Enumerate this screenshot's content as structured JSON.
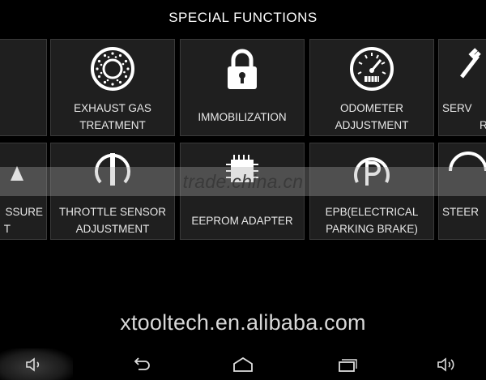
{
  "header": {
    "title": "SPECIAL FUNCTIONS"
  },
  "tiles": [
    {
      "id": "partial-left-top",
      "label1": "",
      "label2": "",
      "icon": "partial-icon"
    },
    {
      "id": "exhaust-gas-treatment",
      "label1": "EXHAUST GAS",
      "label2": "TREATMENT",
      "icon": "exhaust-filter-icon"
    },
    {
      "id": "immobilization",
      "label1": "IMMOBILIZATION",
      "label2": "",
      "icon": "padlock-icon"
    },
    {
      "id": "odometer-adjustment",
      "label1": "ODOMETER",
      "label2": "ADJUSTMENT",
      "icon": "odometer-gauge-icon"
    },
    {
      "id": "service-reset",
      "label1": "SERV",
      "label2": "R",
      "icon": "wrench-icon"
    },
    {
      "id": "tire-pressure",
      "label1": "SSURE",
      "label2": "T",
      "icon": "tire-pressure-icon"
    },
    {
      "id": "throttle-sensor-adjustment",
      "label1": "THROTTLE SENSOR",
      "label2": "ADJUSTMENT",
      "icon": "throttle-icon"
    },
    {
      "id": "eeprom-adapter",
      "label1": "EEPROM ADAPTER",
      "label2": "",
      "icon": "chip-icon"
    },
    {
      "id": "epb",
      "label1": "EPB(ELECTRICAL",
      "label2": "PARKING BRAKE)",
      "icon": "parking-brake-icon"
    },
    {
      "id": "steering",
      "label1": "STEER",
      "label2": "",
      "icon": "steering-icon"
    }
  ],
  "watermarks": {
    "band_text": "trade.china.cn",
    "site_text": "xtooltech.en.alibaba.com"
  },
  "navbar": {
    "buttons": [
      "volume-down-icon",
      "back-icon",
      "home-icon",
      "recent-apps-icon",
      "volume-up-icon"
    ]
  }
}
